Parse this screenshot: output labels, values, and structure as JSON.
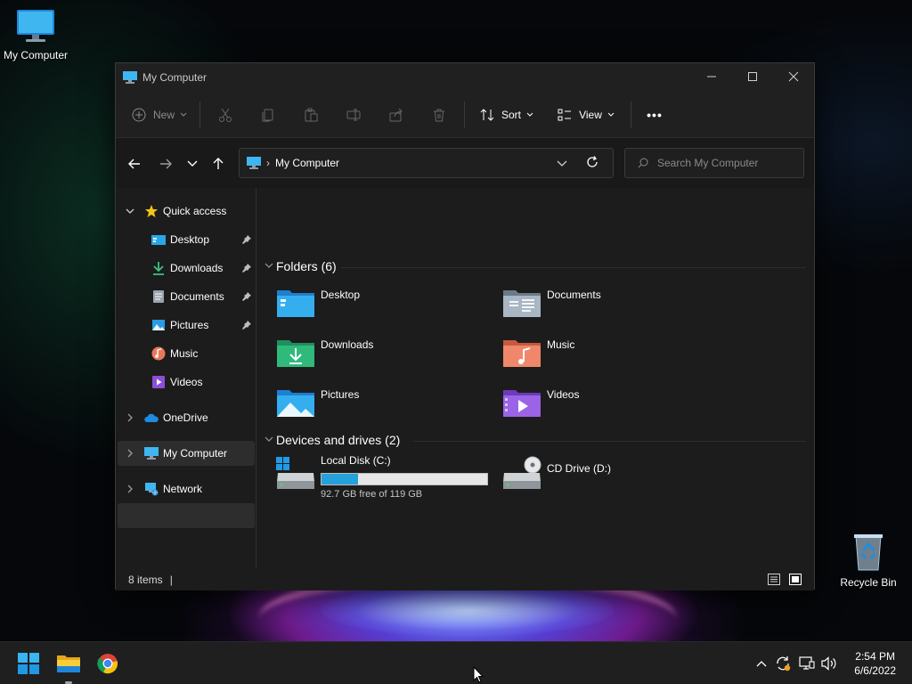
{
  "desktop": {
    "icons": [
      {
        "label": "My Computer",
        "icon": "monitor-icon"
      },
      {
        "label": "Recycle Bin",
        "icon": "recycle-bin-icon"
      }
    ]
  },
  "window": {
    "title": "My Computer",
    "controls": {
      "minimize": "minimize",
      "maximize": "maximize",
      "close": "close"
    }
  },
  "toolbar": {
    "new_label": "New",
    "sort_label": "Sort",
    "view_label": "View",
    "more_label": "•••",
    "disabled_actions": [
      "cut",
      "copy",
      "paste",
      "rename",
      "share",
      "delete"
    ]
  },
  "address": {
    "location": "My Computer",
    "separator": "›"
  },
  "search": {
    "placeholder": "Search My Computer"
  },
  "sidebar": {
    "quick_access": "Quick access",
    "items": [
      {
        "label": "Desktop",
        "icon": "desktop-folder-icon",
        "pinned": true
      },
      {
        "label": "Downloads",
        "icon": "download-icon",
        "pinned": true
      },
      {
        "label": "Documents",
        "icon": "document-icon",
        "pinned": true
      },
      {
        "label": "Pictures",
        "icon": "picture-icon",
        "pinned": true
      },
      {
        "label": "Music",
        "icon": "music-icon",
        "pinned": false
      },
      {
        "label": "Videos",
        "icon": "video-icon",
        "pinned": false
      }
    ],
    "onedrive": "OneDrive",
    "my_computer": "My Computer",
    "network": "Network"
  },
  "content": {
    "folders_header": "Folders (6)",
    "folders": [
      {
        "label": "Desktop",
        "icon": "desktop-folder-icon"
      },
      {
        "label": "Documents",
        "icon": "documents-folder-icon"
      },
      {
        "label": "Downloads",
        "icon": "downloads-folder-icon"
      },
      {
        "label": "Music",
        "icon": "music-folder-icon"
      },
      {
        "label": "Pictures",
        "icon": "pictures-folder-icon"
      },
      {
        "label": "Videos",
        "icon": "videos-folder-icon"
      }
    ],
    "drives_header": "Devices and drives (2)",
    "drives": [
      {
        "label": "Local Disk (C:)",
        "free_text": "92.7 GB free of 119 GB",
        "used_fraction": 0.22
      },
      {
        "label": "CD Drive (D:)"
      }
    ]
  },
  "status": {
    "items_count": "8 items"
  },
  "taskbar": {
    "apps": [
      "start-icon",
      "file-explorer-icon",
      "chrome-icon"
    ],
    "tray": [
      "chevron-up-icon",
      "sync-icon",
      "network-icon",
      "volume-icon"
    ],
    "time": "2:54 PM",
    "date": "6/6/2022"
  },
  "colors": {
    "accent": "#26a0da",
    "window_bg": "#1c1c1c",
    "titlebar_bg": "#202020",
    "taskbar_bg": "#1f1f1f"
  }
}
